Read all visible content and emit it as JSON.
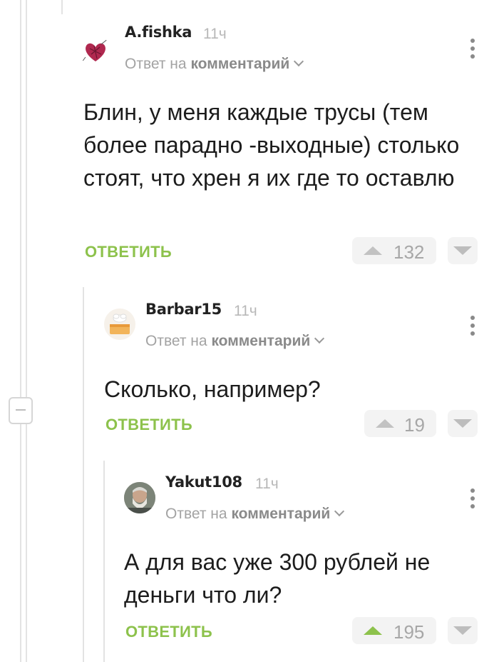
{
  "comments": [
    {
      "author": "A.fishka",
      "time": "11ч",
      "reply_prefix": "Ответ на",
      "reply_link": "комментарий",
      "text": "Блин, у меня каждые трусы (тем более парадно -выходные) столько стоят, что хрен я их где то оставлю",
      "reply_label": "ОТВЕТИТЬ",
      "rating": "132",
      "upvoted": false,
      "avatar": "heart-sketch-avatar"
    },
    {
      "author": "Barbar15",
      "time": "11ч",
      "reply_prefix": "Ответ на",
      "reply_link": "комментарий",
      "text": "Сколько, например?",
      "reply_label": "ОТВЕТИТЬ",
      "rating": "19",
      "upvoted": false,
      "avatar": "cake-avatar"
    },
    {
      "author": "Yakut108",
      "time": "11ч",
      "reply_prefix": "Ответ на",
      "reply_link": "комментарий",
      "text": "А для вас уже 300 рублей не деньги что ли?",
      "reply_label": "ОТВЕТИТЬ",
      "rating": "195",
      "upvoted": true,
      "avatar": "bearded-man-photo-avatar"
    }
  ],
  "colors": {
    "accent_green": "#8dc24c",
    "muted_text": "#a3a3a3",
    "thread_line": "#e3e3e3"
  },
  "icons": [
    "collapse-thread-icon",
    "more-options-icon",
    "chevron-down-icon",
    "upvote-arrow-icon",
    "downvote-arrow-icon"
  ]
}
